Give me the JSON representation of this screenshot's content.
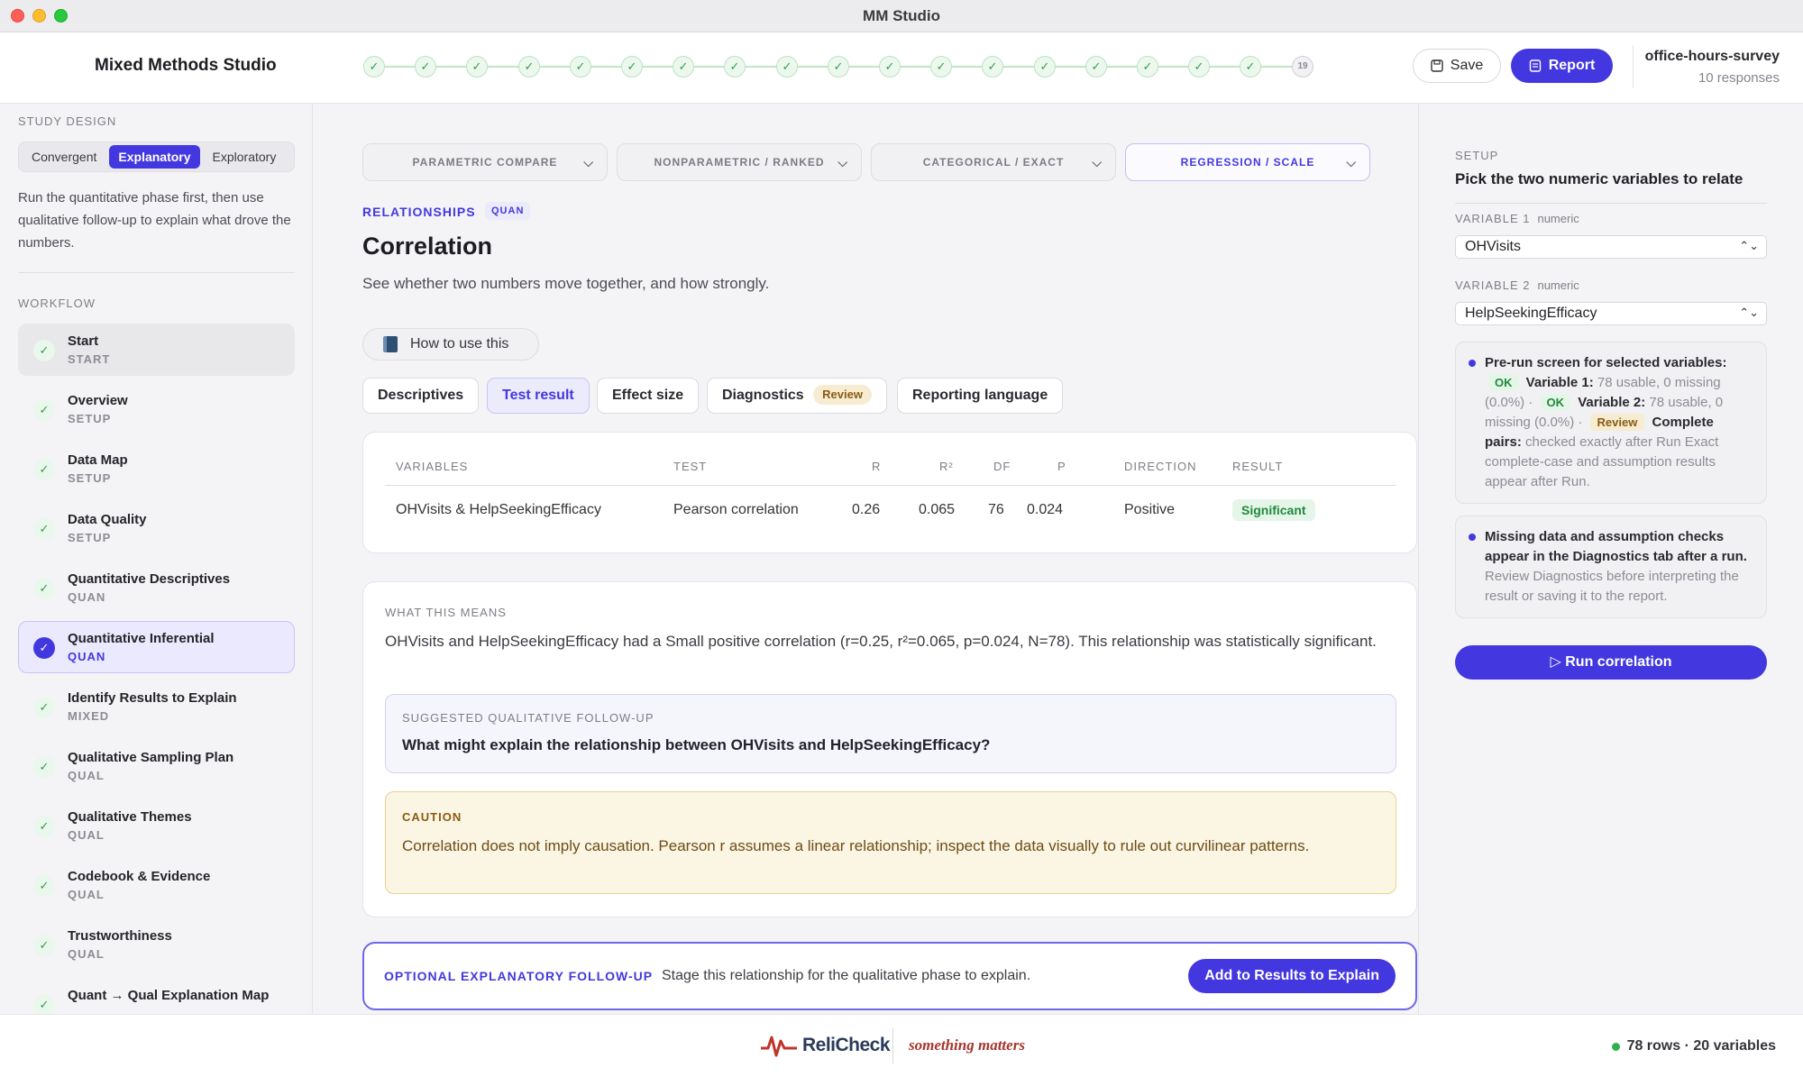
{
  "window": {
    "title": "MM Studio"
  },
  "header": {
    "app_name": "Mixed Methods Studio",
    "steps_done_mark": "✓",
    "last_step": "19",
    "save_label": "Save",
    "report_label": "Report",
    "survey_name": "office-hours-survey",
    "survey_count": "10 responses"
  },
  "sidebar": {
    "study_design_label": "STUDY DESIGN",
    "design_options": [
      "Convergent",
      "Explanatory",
      "Exploratory"
    ],
    "design_selected": "Explanatory",
    "design_desc": "Run the quantitative phase first, then use qualitative follow-up to explain what drove the numbers.",
    "workflow_label": "WORKFLOW",
    "items": [
      {
        "title": "Start",
        "sub": "START"
      },
      {
        "title": "Overview",
        "sub": "SETUP"
      },
      {
        "title": "Data Map",
        "sub": "SETUP"
      },
      {
        "title": "Data Quality",
        "sub": "SETUP"
      },
      {
        "title": "Quantitative Descriptives",
        "sub": "QUAN"
      },
      {
        "title": "Quantitative Inferential",
        "sub": "QUAN"
      },
      {
        "title": "Identify Results to Explain",
        "sub": "MIXED"
      },
      {
        "title": "Qualitative Sampling Plan",
        "sub": "QUAL"
      },
      {
        "title": "Qualitative Themes",
        "sub": "QUAL"
      },
      {
        "title": "Codebook & Evidence",
        "sub": "QUAL"
      },
      {
        "title": "Trustworthiness",
        "sub": "QUAL"
      },
      {
        "title": "Quant → Qual Explanation Map",
        "sub": ""
      }
    ]
  },
  "main": {
    "category_tabs": [
      "PARAMETRIC COMPARE",
      "NONPARAMETRIC / RANKED",
      "CATEGORICAL / EXACT",
      "REGRESSION / SCALE"
    ],
    "kicker": "RELATIONSHIPS",
    "kicker_badge": "QUAN",
    "title": "Correlation",
    "description": "See whether two numbers move together, and how strongly.",
    "howto_label": "How to use this",
    "subtabs": [
      "Descriptives",
      "Test result",
      "Effect size",
      "Diagnostics",
      "Reporting language"
    ],
    "diagnostics_badge": "Review",
    "table": {
      "headers": [
        "VARIABLES",
        "TEST",
        "R",
        "R²",
        "DF",
        "P",
        "DIRECTION",
        "RESULT"
      ],
      "row": {
        "variables": "OHVisits & HelpSeekingEfficacy",
        "test": "Pearson correlation",
        "r": "0.26",
        "r2": "0.065",
        "df": "76",
        "p": "0.024",
        "direction": "Positive",
        "result": "Significant"
      }
    },
    "meaning_label": "WHAT THIS MEANS",
    "meaning_text": "OHVisits and HelpSeekingEfficacy had a Small positive correlation (r=0.25, r²=0.065, p=0.024, N=78). This relationship was statistically significant.",
    "followup_label": "SUGGESTED QUALITATIVE FOLLOW-UP",
    "followup_question": "What might explain the relationship between OHVisits and HelpSeekingEfficacy?",
    "caution_label": "CAUTION",
    "caution_text": "Correlation does not imply causation. Pearson r assumes a linear relationship; inspect the data visually to rule out curvilinear patterns.",
    "optional_label": "OPTIONAL EXPLANATORY FOLLOW-UP",
    "optional_text": "Stage this relationship for the qualitative phase to explain.",
    "optional_button": "Add to Results to Explain"
  },
  "right_panel": {
    "kicker": "SETUP",
    "title": "Pick the two numeric variables to relate",
    "var1_label": "VARIABLE 1",
    "var1_type": "numeric",
    "var1_value": "OHVisits",
    "var2_label": "VARIABLE 2",
    "var2_type": "numeric",
    "var2_value": "HelpSeekingEfficacy",
    "prerun_title": "Pre-run screen for selected variables:",
    "ok_label": "OK",
    "v1_name": "Variable 1:",
    "v1_text": "78 usable, 0 missing (0.0%) ·",
    "v2_name": "Variable 2:",
    "v2_text": "78 usable, 0 missing (0.0%) ·",
    "review_label": "Review",
    "pairs_name": "Complete pairs:",
    "pairs_text": "checked exactly after Run Exact complete-case and assumption results appear after Run.",
    "missing_title": "Missing data and assumption checks appear in the Diagnostics tab after a run.",
    "missing_text": "Review Diagnostics before interpreting the result or saving it to the report.",
    "run_button": "▷ Run correlation"
  },
  "footer": {
    "logo_text": "ReliCheck",
    "tagline": "something matters",
    "status": "78 rows · 20 variables"
  },
  "colors": {
    "accent": "#4338e0",
    "success": "#2fa04a",
    "warning_bg": "#fbf5e3"
  }
}
